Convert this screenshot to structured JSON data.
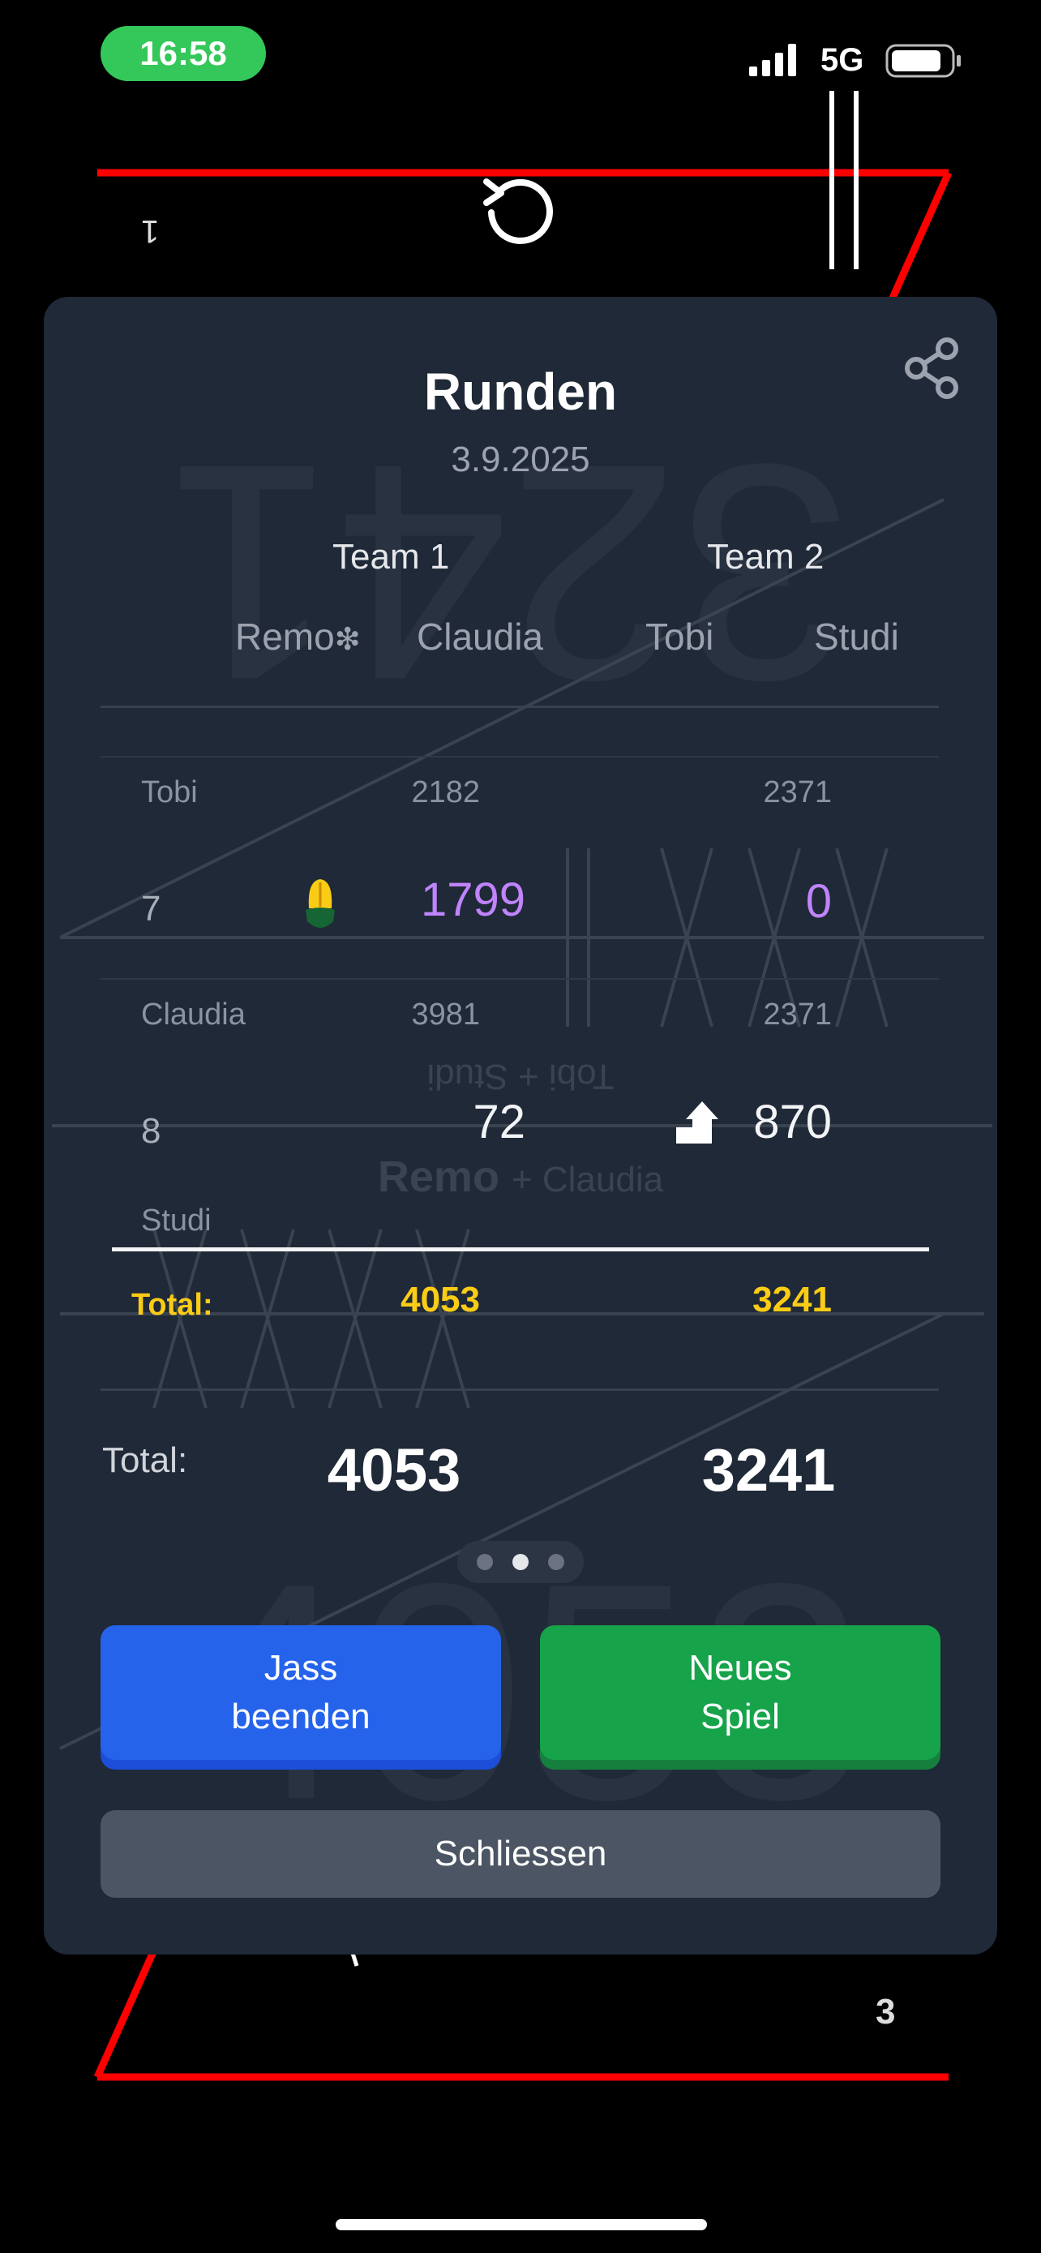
{
  "status": {
    "time": "16:58",
    "network": "5G"
  },
  "background": {
    "top_left_mark": "1",
    "bottom_right_number": "3"
  },
  "modal": {
    "title": "Runden",
    "date": "3.9.2025",
    "watermark_top": "3241",
    "watermark_bottom": "4053",
    "ghost_text_1": "Tobi + Studi",
    "ghost_text_2_bold": "Remo",
    "ghost_text_2_rest": "+ Claudia",
    "teams": [
      {
        "label": "Team 1",
        "players": [
          "Remo",
          "Claudia"
        ]
      },
      {
        "label": "Team 2",
        "players": [
          "Tobi",
          "Studi"
        ]
      }
    ],
    "starter_symbol": "❇",
    "rounds": [
      {
        "dealer": "Tobi",
        "sub_team1": "2182",
        "sub_team2": "2371",
        "number": "7",
        "team1": "1799",
        "team2": "0"
      },
      {
        "dealer": "Claudia",
        "sub_team1": "3981",
        "sub_team2": "2371",
        "number": "8",
        "team1": "72",
        "team2": "870"
      }
    ],
    "next_dealer": "Studi",
    "table_total": {
      "label": "Total:",
      "team1": "4053",
      "team2": "3241"
    },
    "grand_total": {
      "label": "Total:",
      "team1": "4053",
      "team2": "3241"
    },
    "pager": {
      "pages": 3,
      "active": 1
    },
    "buttons": {
      "end_line1": "Jass",
      "end_line2": "beenden",
      "new_line1": "Neues",
      "new_line2": "Spiel",
      "close": "Schliessen"
    }
  },
  "colors": {
    "team2_accent": "#c084fc",
    "total": "#facc15",
    "primary": "#2563eb",
    "success": "#16a34a"
  }
}
